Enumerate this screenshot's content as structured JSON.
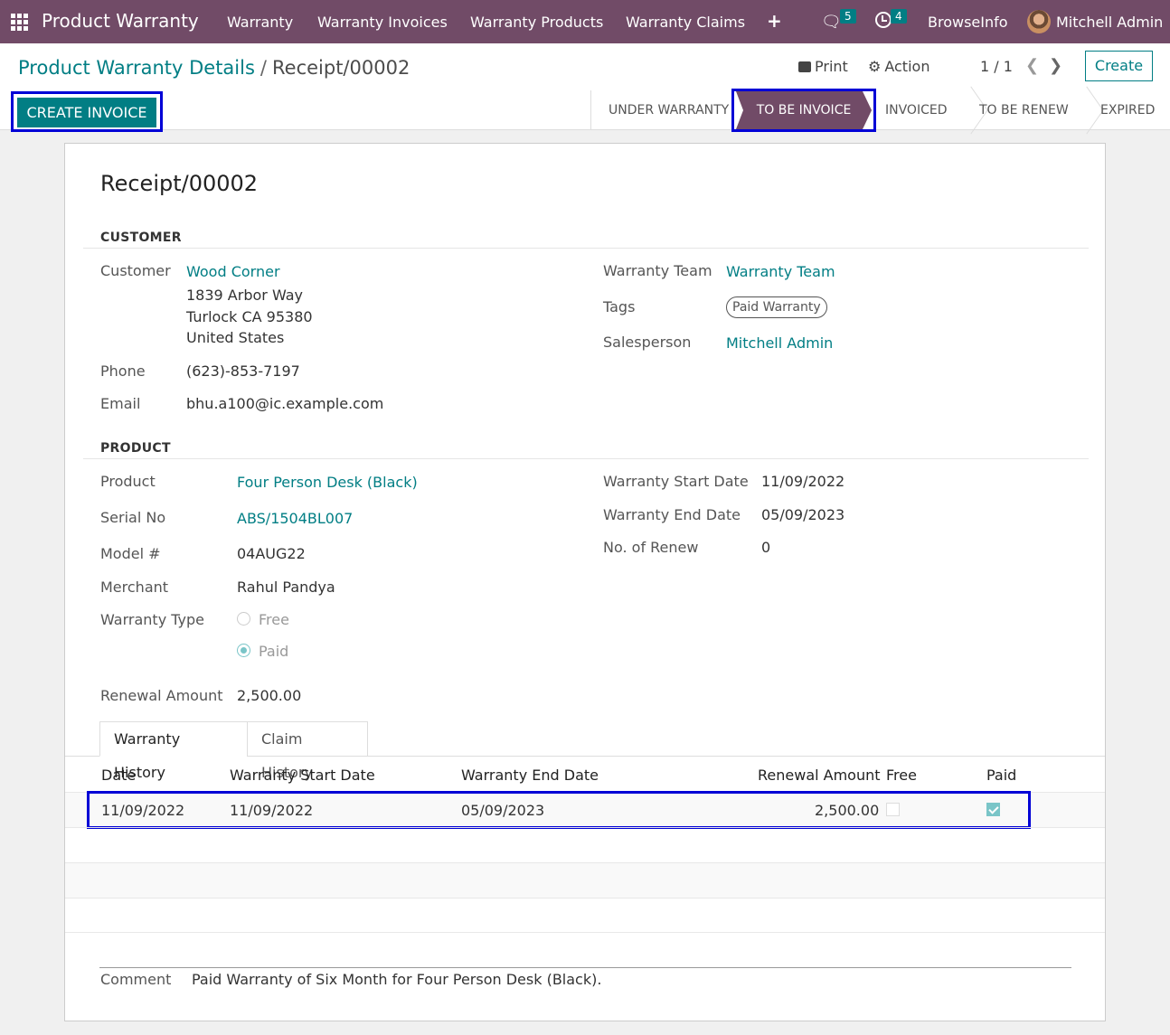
{
  "navbar": {
    "app_title": "Product Warranty",
    "menu": [
      "Warranty",
      "Warranty Invoices",
      "Warranty Products",
      "Warranty Claims"
    ],
    "messages_count": "5",
    "activities_count": "4",
    "company": "BrowseInfo",
    "user": "Mitchell Admin"
  },
  "control": {
    "breadcrumb_parent": "Product Warranty Details",
    "breadcrumb_separator": "/",
    "breadcrumb_current": "Receipt/00002",
    "print_label": "Print",
    "action_label": "Action",
    "pager": "1 / 1",
    "create_label": "Create",
    "create_invoice_label": "CREATE INVOICE"
  },
  "stages": {
    "items": [
      "UNDER WARRANTY",
      "TO BE INVOICE",
      "INVOICED",
      "TO BE RENEW",
      "EXPIRED"
    ],
    "active": "TO BE INVOICE"
  },
  "record": {
    "title": "Receipt/00002",
    "customer_section": "CUSTOMER",
    "customer_label": "Customer",
    "customer_name": "Wood Corner",
    "address_line1": "1839 Arbor Way",
    "address_line2": "Turlock CA 95380",
    "address_line3": "United States",
    "phone_label": "Phone",
    "phone": "(623)-853-7197",
    "email_label": "Email",
    "email": "bhu.a100@ic.example.com",
    "team_label": "Warranty Team",
    "team": "Warranty Team",
    "tags_label": "Tags",
    "tag": "Paid Warranty",
    "salesperson_label": "Salesperson",
    "salesperson": "Mitchell Admin",
    "product_section": "PRODUCT",
    "product_label": "Product",
    "product": "Four Person Desk (Black)",
    "serial_label": "Serial No",
    "serial": "ABS/1504BL007",
    "model_label": "Model #",
    "model": "04AUG22",
    "merchant_label": "Merchant",
    "merchant": "Rahul Pandya",
    "warranty_type_label": "Warranty Type",
    "warranty_type_free": "Free",
    "warranty_type_paid": "Paid",
    "renewal_label": "Renewal Amount",
    "renewal": "2,500.00",
    "start_label": "Warranty Start Date",
    "start": "11/09/2022",
    "end_label": "Warranty End Date",
    "end": "05/09/2023",
    "renew_count_label": "No. of Renew",
    "renew_count": "0"
  },
  "tabs": [
    "Warranty History",
    "Claim History"
  ],
  "history": {
    "headers": [
      "Date",
      "Warranty Start Date",
      "Warranty End Date",
      "Renewal Amount",
      "Free",
      "Paid"
    ],
    "rows": [
      {
        "date": "11/09/2022",
        "start": "11/09/2022",
        "end": "05/09/2023",
        "amount": "2,500.00",
        "free": false,
        "paid": true
      }
    ]
  },
  "comment": {
    "label": "Comment",
    "text": "Paid Warranty of Six Month for Four Person Desk (Black)."
  },
  "colors": {
    "brand": "#714b67",
    "accent": "#017e84",
    "highlight": "#0000d6"
  }
}
